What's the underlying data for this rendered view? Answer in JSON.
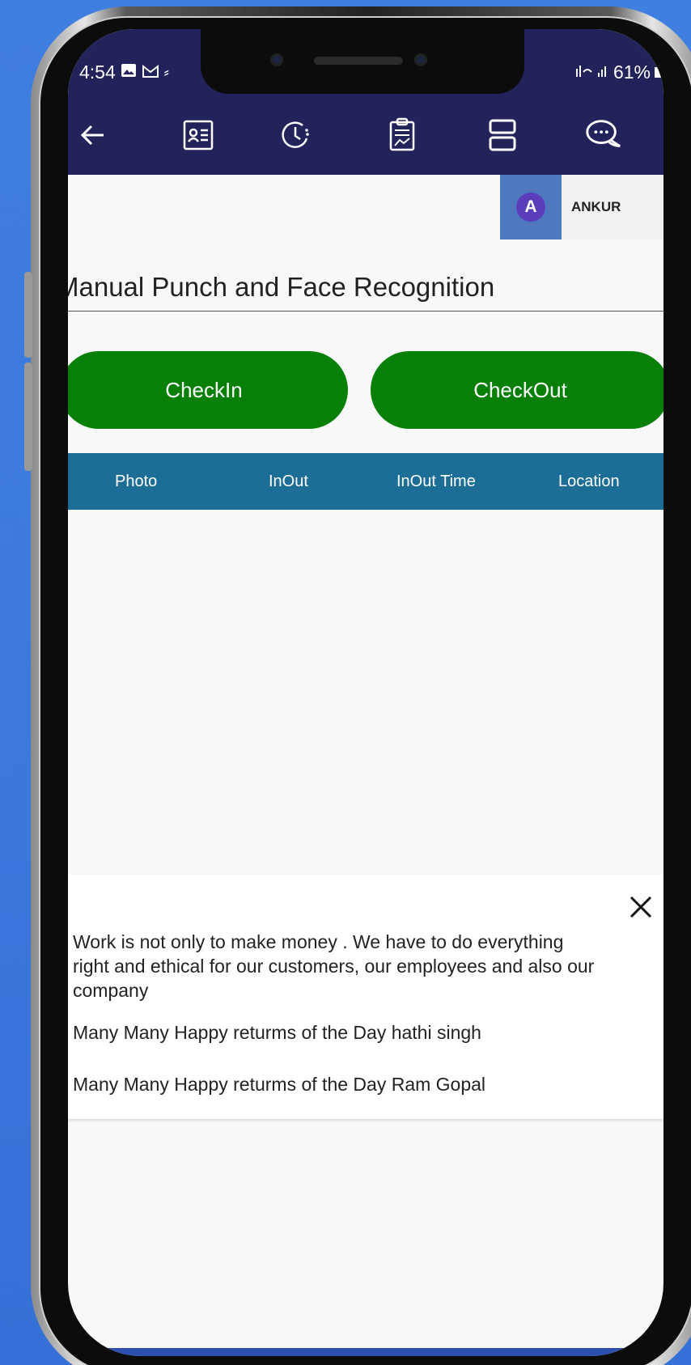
{
  "status_bar": {
    "time": "4:54",
    "battery": "61%",
    "icons": [
      "gallery-icon",
      "gmail-icon",
      "signal-icon",
      "wifi-calling-icon",
      "battery-icon"
    ]
  },
  "toolbar": {
    "icons": [
      "back-arrow-icon",
      "id-card-icon",
      "clock-history-icon",
      "clipboard-report-icon",
      "layout-icon",
      "chat-icon"
    ]
  },
  "user": {
    "initial": "A",
    "name": "ANKUR"
  },
  "page": {
    "title": "Manual Punch and Face Recognition"
  },
  "actions": {
    "checkin_label": "CheckIn",
    "checkout_label": "CheckOut"
  },
  "table": {
    "columns": [
      "Photo",
      "InOut",
      "InOut Time",
      "Location"
    ]
  },
  "notice": {
    "messages": [
      "Work is not only to make money .  We have to do everything right and ethical for our customers, our employees and also our company",
      "Many Many Happy returms of the Day hathi singh",
      "Many Many Happy returms of the Day Ram Gopal"
    ]
  },
  "colors": {
    "appbar": "#23235c",
    "button_green": "#088008",
    "table_header": "#1d6e96",
    "avatar": "#5b3dbb",
    "background": "#3f7fe0"
  }
}
